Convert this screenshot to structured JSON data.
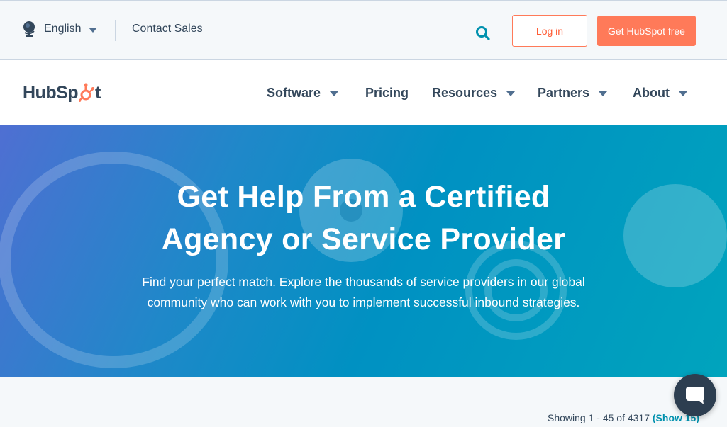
{
  "utility": {
    "language": "English",
    "contact": "Contact Sales",
    "login": "Log in",
    "cta": "Get HubSpot free"
  },
  "nav": {
    "logo_left": "HubSp",
    "logo_right": "t",
    "items": [
      {
        "label": "Software",
        "dropdown": true
      },
      {
        "label": "Pricing",
        "dropdown": false
      },
      {
        "label": "Resources",
        "dropdown": true
      },
      {
        "label": "Partners",
        "dropdown": true
      },
      {
        "label": "About",
        "dropdown": true
      }
    ]
  },
  "hero": {
    "title_line1": "Get Help From a Certified",
    "title_line2": "Agency or Service Provider",
    "subtitle_line1": "Find your perfect match. Explore the thousands of service providers in our global",
    "subtitle_line2": "community who can work with you to implement successful inbound strategies."
  },
  "results": {
    "showing": "Showing 1 - 45 of 4317",
    "show_link": "(Show 15)"
  },
  "colors": {
    "accent": "#ff7a59",
    "text": "#33475b",
    "link": "#0091ae"
  },
  "icons": [
    "globe-icon",
    "search-icon",
    "chevron-down-icon",
    "chat-icon",
    "sprocket-icon"
  ]
}
